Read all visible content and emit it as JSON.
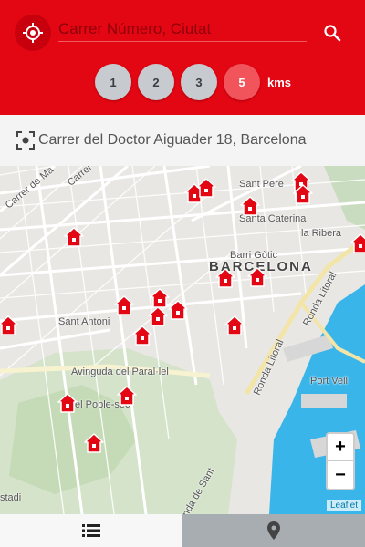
{
  "search": {
    "placeholder": "Carrer Número, Ciutat"
  },
  "radius": {
    "options": [
      "1",
      "2",
      "3",
      "5"
    ],
    "selected": "5",
    "unit": "kms"
  },
  "address": {
    "text": "Carrer del Doctor Aiguader 18, Barcelona"
  },
  "map": {
    "labels": {
      "sant_pere": "Sant Pere",
      "santa_caterina": "Santa Caterina",
      "la_ribera": "la Ribera",
      "barri_gotic": "Barri Gòtic",
      "barcelona": "BARCELONA",
      "sant_antoni": "Sant Antoni",
      "paral_lel": "Avinguda del Paral·lel",
      "poble_sec": "el Poble-sec",
      "port_vell": "Port Vell",
      "ronda_litoral_1": "Ronda Litoral",
      "ronda_litoral_2": "Ronda Litoral",
      "carrer_de_ma": "Carrer de Ma",
      "carrer_2": "Carrer",
      "stadi": "stadi",
      "ronda_sant": "nda de Sant"
    },
    "zoom_in": "+",
    "zoom_out": "−",
    "attribution": "Leaflet"
  },
  "colors": {
    "brand": "#e30613",
    "active_radius": "#f2545b",
    "water": "#3ab5ea",
    "marker": "#e30613"
  }
}
